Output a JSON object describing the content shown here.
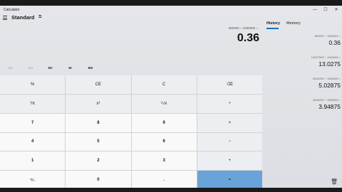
{
  "window": {
    "title": "Calculator",
    "controls": {
      "minimize": "—",
      "maximize": "☐",
      "close": "✕"
    }
  },
  "mode": {
    "name": "Standard",
    "keep_on_top_icon": "⧉"
  },
  "display": {
    "expression": "360000 ÷ 1000000 =",
    "value": "0.36"
  },
  "memory_buttons": [
    {
      "label": "MC",
      "enabled": false
    },
    {
      "label": "MR",
      "enabled": false
    },
    {
      "label": "M+",
      "enabled": true
    },
    {
      "label": "M-",
      "enabled": true
    },
    {
      "label": "MS",
      "enabled": true
    }
  ],
  "keypad": [
    [
      "%",
      "CE",
      "C",
      "⌫"
    ],
    [
      "⅟x",
      "x²",
      "²√x",
      "÷"
    ],
    [
      "7",
      "8",
      "9",
      "×"
    ],
    [
      "4",
      "5",
      "6",
      "−"
    ],
    [
      "1",
      "2",
      "3",
      "+"
    ],
    [
      "⁺∕₋",
      "0",
      ".",
      "="
    ]
  ],
  "side_panel": {
    "tabs": [
      "History",
      "Memory"
    ],
    "active_tab": "History",
    "history": [
      {
        "expression": "360000 ÷ 1000000 =",
        "result": "0.36"
      },
      {
        "expression": "13027500 ÷ 1000000 =",
        "result": "13.0275"
      },
      {
        "expression": "5028750 ÷ 1000000 =",
        "result": "5.02875"
      },
      {
        "expression": "3948750 ÷ 1000000 =",
        "result": "3.94875"
      }
    ]
  },
  "colors": {
    "accent": "#1a6fbd",
    "equals_key": "#6aa3d8"
  }
}
